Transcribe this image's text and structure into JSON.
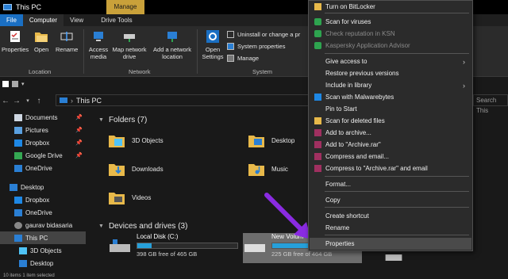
{
  "window": {
    "title": "This PC",
    "manage_tab": "Manage"
  },
  "tabs": [
    {
      "label": "File"
    },
    {
      "label": "Computer"
    },
    {
      "label": "View"
    },
    {
      "label": "Drive Tools"
    }
  ],
  "ribbon": {
    "location": {
      "properties": "Properties",
      "open": "Open",
      "rename": "Rename",
      "group": "Location"
    },
    "network": {
      "access_media": "Access media",
      "map_drive": "Map network drive",
      "add_location": "Add a network location",
      "group": "Network"
    },
    "system": {
      "open_settings": "Open Settings",
      "uninstall": "Uninstall or change a pr",
      "system_properties": "System properties",
      "manage": "Manage",
      "group": "System"
    }
  },
  "address": {
    "path": "This PC",
    "search_placeholder": "Search This"
  },
  "nav": {
    "items": [
      {
        "label": "Documents"
      },
      {
        "label": "Pictures"
      },
      {
        "label": "Dropbox"
      },
      {
        "label": "Google Drive"
      },
      {
        "label": "OneDrive"
      },
      {
        "label": "Desktop"
      },
      {
        "label": "Dropbox"
      },
      {
        "label": "OneDrive"
      },
      {
        "label": "gaurav bidasaria"
      },
      {
        "label": "This PC"
      },
      {
        "label": "3D Objects"
      },
      {
        "label": "Desktop"
      }
    ]
  },
  "folders": {
    "header": "Folders (7)",
    "items": [
      {
        "label": "3D Objects"
      },
      {
        "label": "Desktop"
      },
      {
        "label": "Downloads"
      },
      {
        "label": "Music"
      },
      {
        "label": "Videos"
      }
    ]
  },
  "drives": {
    "header": "Devices and drives (3)",
    "items": [
      {
        "name": "Local Disk (C:)",
        "free": "398 GB free of 465 GB",
        "used_percent": 14
      },
      {
        "name": "New Volum",
        "free": "225 GB free of 464 GB",
        "used_percent": 51
      }
    ]
  },
  "status": {
    "text": "10 items    1 item selected"
  },
  "context_menu": {
    "items": [
      {
        "label": "Turn on BitLocker"
      },
      {
        "label": "Scan for viruses"
      },
      {
        "label": "Check reputation in KSN"
      },
      {
        "label": "Kaspersky Application Advisor"
      },
      {
        "label": "Give access to"
      },
      {
        "label": "Restore previous versions"
      },
      {
        "label": "Include in library"
      },
      {
        "label": "Scan with Malwarebytes"
      },
      {
        "label": "Pin to Start"
      },
      {
        "label": "Scan for deleted files"
      },
      {
        "label": "Add to archive..."
      },
      {
        "label": "Add to \"Archive.rar\""
      },
      {
        "label": "Compress and email..."
      },
      {
        "label": "Compress to \"Archive.rar\" and email"
      },
      {
        "label": "Format..."
      },
      {
        "label": "Copy"
      },
      {
        "label": "Create shortcut"
      },
      {
        "label": "Rename"
      },
      {
        "label": "Properties"
      }
    ]
  },
  "colors": {
    "accent": "#1a6fc3",
    "manage_tab": "#c9a13a",
    "drive_bar": "#26a0da",
    "arrow": "#8a2be2"
  }
}
